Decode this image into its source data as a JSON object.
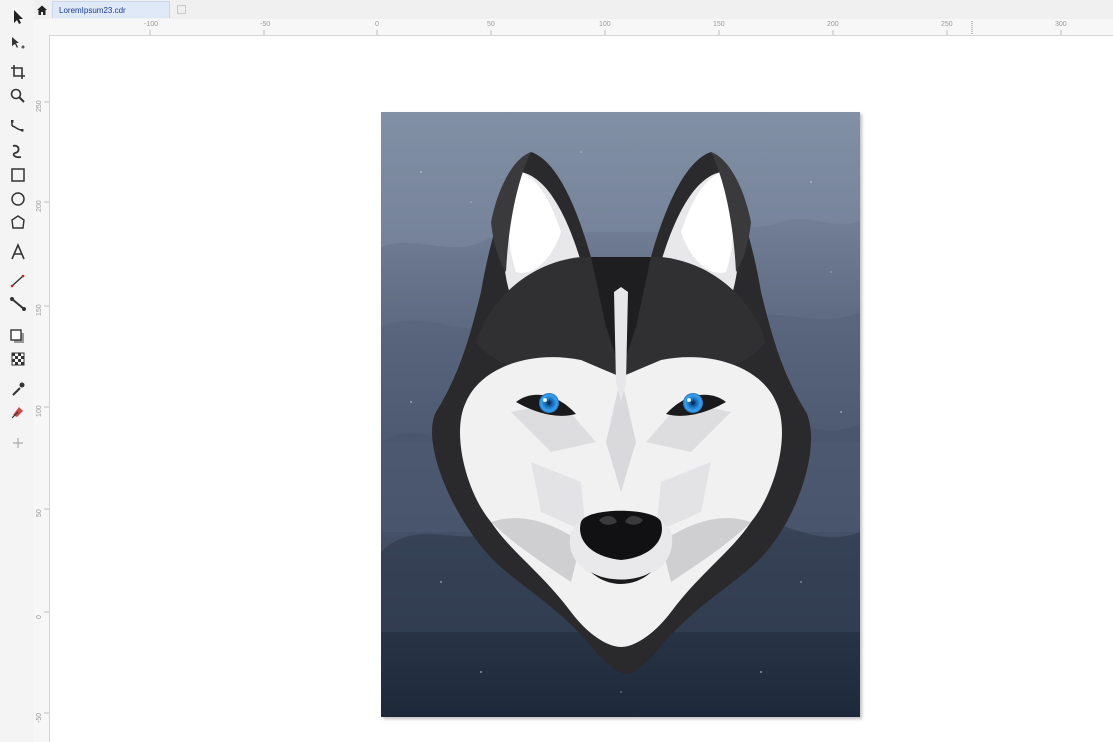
{
  "tabs": {
    "document_name": "LoremIpsum23.cdr"
  },
  "ruler": {
    "horizontal_labels": [
      "-100",
      "-50",
      "0",
      "50",
      "100",
      "150",
      "200",
      "250",
      "300"
    ],
    "vertical_labels": [
      "250",
      "200",
      "150",
      "100",
      "50",
      "0",
      "-50"
    ]
  },
  "toolbox": {
    "tools": [
      "pick-tool-icon",
      "shape-tool-icon",
      "crop-tool-icon",
      "zoom-tool-icon",
      "freehand-tool-icon",
      "artistic-media-tool-icon",
      "rectangle-tool-icon",
      "ellipse-tool-icon",
      "polygon-tool-icon",
      "text-tool-icon",
      "parallel-dimension-tool-icon",
      "connector-tool-icon",
      "drop-shadow-tool-icon",
      "transparency-tool-icon",
      "color-eyedropper-tool-icon",
      "interactive-fill-tool-icon",
      "add-tool-icon"
    ]
  },
  "colors": {
    "sky_top": "#7f8ca3",
    "sky_bottom": "#0f1b2c",
    "eye": "#2b8fe0",
    "fur_dark": "#2a2a2c",
    "fur_light": "#f2f2f2"
  }
}
